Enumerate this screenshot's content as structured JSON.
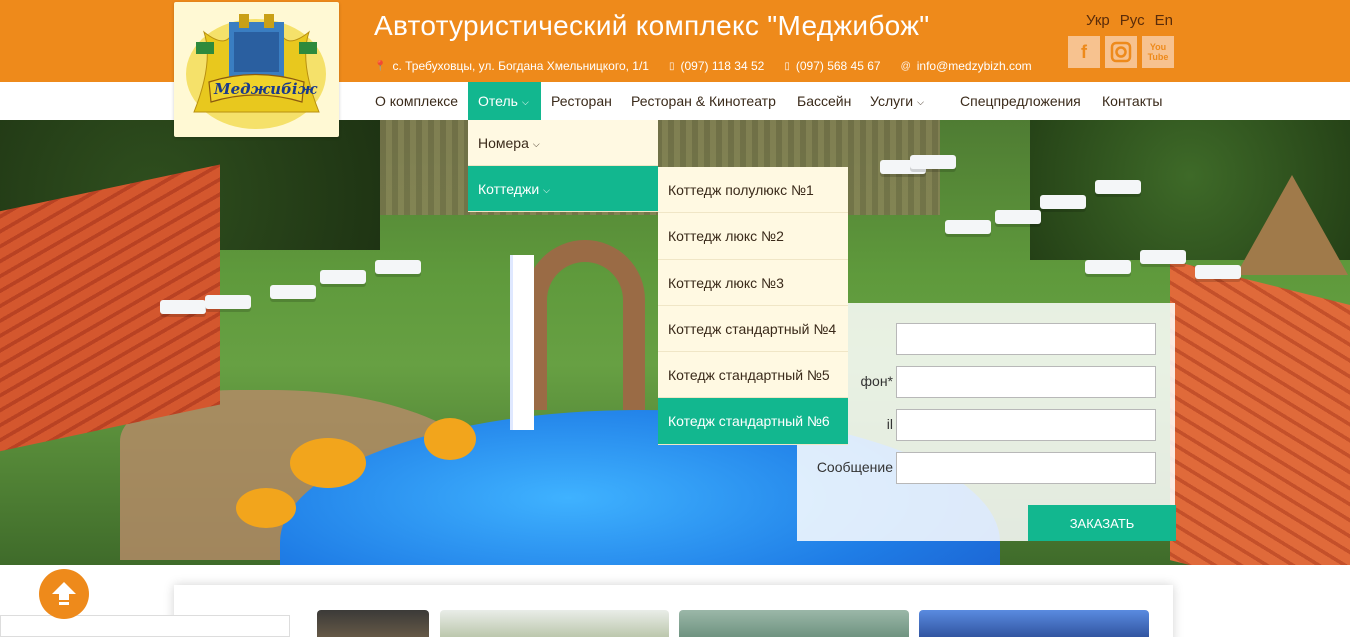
{
  "header": {
    "title": "Автотуристический комплекс \"Меджибож\"",
    "address": "с. Требуховцы, ул. Богдана Хмельницкого, 1/1",
    "phone1": "(097) 118 34 52",
    "phone2": "(097) 568 45 67",
    "email": "info@medzybizh.com",
    "languages": [
      "Укр",
      "Рус",
      "En"
    ],
    "socials": [
      {
        "name": "facebook-icon",
        "glyph": "f"
      },
      {
        "name": "instagram-icon",
        "glyph": "◙"
      },
      {
        "name": "youtube-icon",
        "glyph": "You Tube"
      }
    ]
  },
  "logo": {
    "text": "Меджибіж"
  },
  "nav": {
    "items": [
      {
        "label": "О комплексе"
      },
      {
        "label": "Отель",
        "active": true,
        "has_dropdown": true
      },
      {
        "label": "Ресторан"
      },
      {
        "label": "Ресторан & Кинотеатр"
      },
      {
        "label": "Бассейн"
      },
      {
        "label": "Услуги",
        "has_dropdown": true
      },
      {
        "label": "Спецпредложения"
      },
      {
        "label": "Контакты"
      }
    ]
  },
  "hotel_menu": {
    "items": [
      {
        "label": "Номера",
        "has_dropdown": true
      },
      {
        "label": "Коттеджи",
        "has_dropdown": true,
        "active": true
      }
    ]
  },
  "cottages_menu": {
    "items": [
      {
        "label": "Коттедж полулюкс №1"
      },
      {
        "label": "Коттедж люкс №2"
      },
      {
        "label": "Коттедж люкс №3"
      },
      {
        "label": "Коттедж стандартный №4"
      },
      {
        "label": "Котедж стандартный №5"
      },
      {
        "label": "Котедж стандартный №6",
        "active": true
      }
    ]
  },
  "booking_form": {
    "fields": [
      {
        "label": "",
        "value": ""
      },
      {
        "label": "фон*",
        "value": ""
      },
      {
        "label": "il",
        "value": ""
      },
      {
        "label": "Сообщение",
        "value": ""
      }
    ],
    "submit_label": "ЗАКАЗАТЬ"
  },
  "colors": {
    "brand_orange": "#ee8a1b",
    "accent_green": "#12b78f",
    "dropdown_bg": "#fff9e2"
  }
}
